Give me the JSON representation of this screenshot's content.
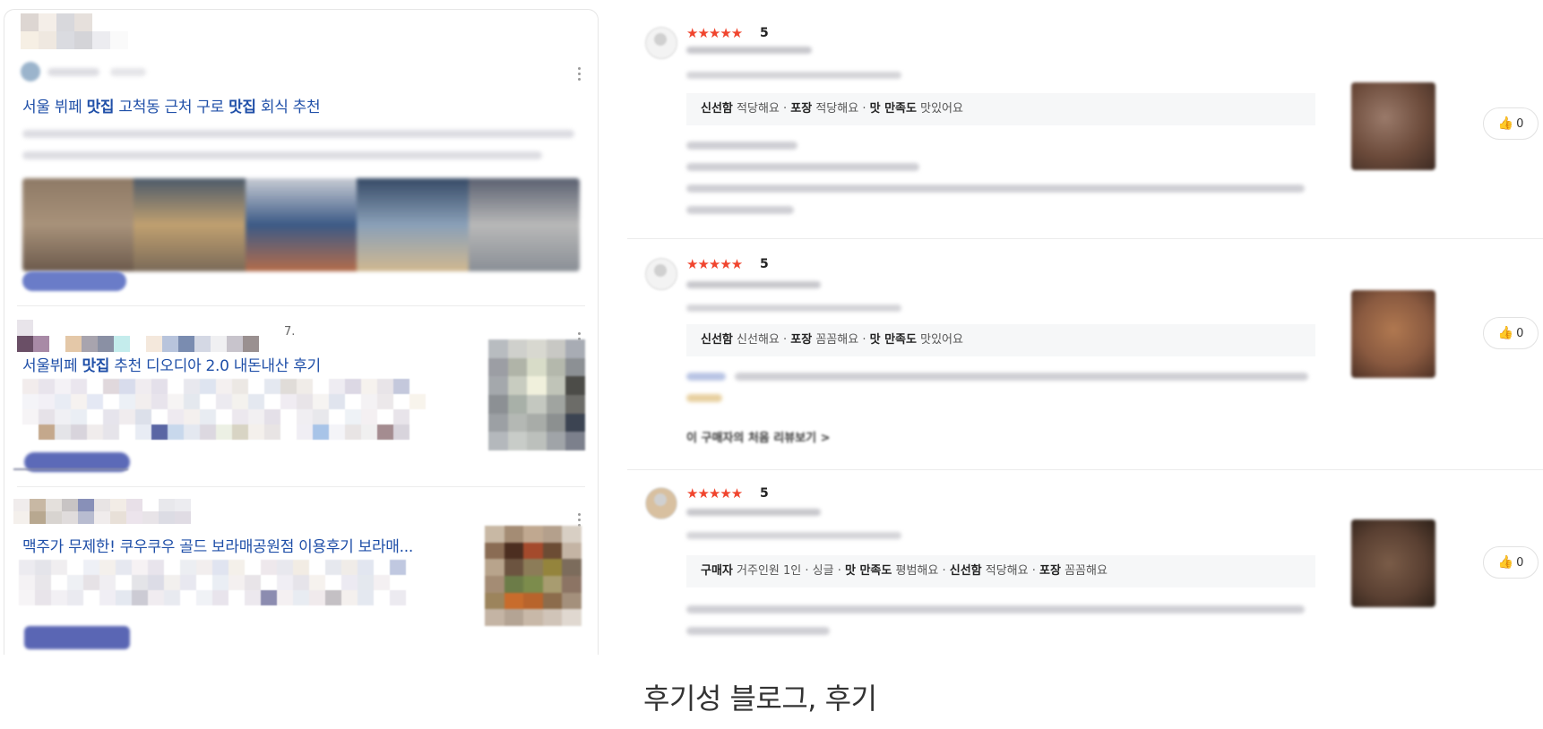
{
  "blog_panel": {
    "posts": [
      {
        "title_parts": [
          "서울 뷔페 ",
          "맛집",
          " 고척동 근처 구로 ",
          "맛집",
          " 회식 추천"
        ]
      },
      {
        "title_parts": [
          "서울뷔페 ",
          "맛집",
          " 추천 디오디아 2.0 내돈내산 후기"
        ],
        "header_suffix": "7."
      },
      {
        "title_parts": [
          "맥주가 무제한! 쿠우쿠우 골드 보라매공원점 이용후기 보라매..."
        ]
      }
    ]
  },
  "reviews": {
    "items": [
      {
        "stars": "★★★★★",
        "rating": "5",
        "attributes": [
          [
            "신선함",
            "적당해요"
          ],
          [
            "포장",
            "적당해요"
          ],
          [
            "맛 만족도",
            "맛있어요"
          ]
        ],
        "likes": "0",
        "photo_color": "#6b4a3a"
      },
      {
        "stars": "★★★★★",
        "rating": "5",
        "attributes": [
          [
            "신선함",
            "신선해요"
          ],
          [
            "포장",
            "꼼꼼해요"
          ],
          [
            "맛 만족도",
            "맛있어요"
          ]
        ],
        "likes": "0",
        "photo_color": "#8a5a40",
        "more_link": "이 구매자의 처음 리뷰보기 >"
      },
      {
        "stars": "★★★★★",
        "rating": "5",
        "attributes": [
          [
            "구매자",
            "거주인원 1인 · 싱글"
          ],
          [
            "맛 만족도",
            "평범해요"
          ],
          [
            "신선함",
            "적당해요"
          ],
          [
            "포장",
            "꼼꼼해요"
          ]
        ],
        "likes": "0",
        "photo_color": "#5a4032"
      }
    ]
  },
  "caption": "후기성 블로그, 후기",
  "colors": {
    "star": "#f0452e",
    "link": "#1f4fa8",
    "attr_bg": "#f6f7f8"
  }
}
